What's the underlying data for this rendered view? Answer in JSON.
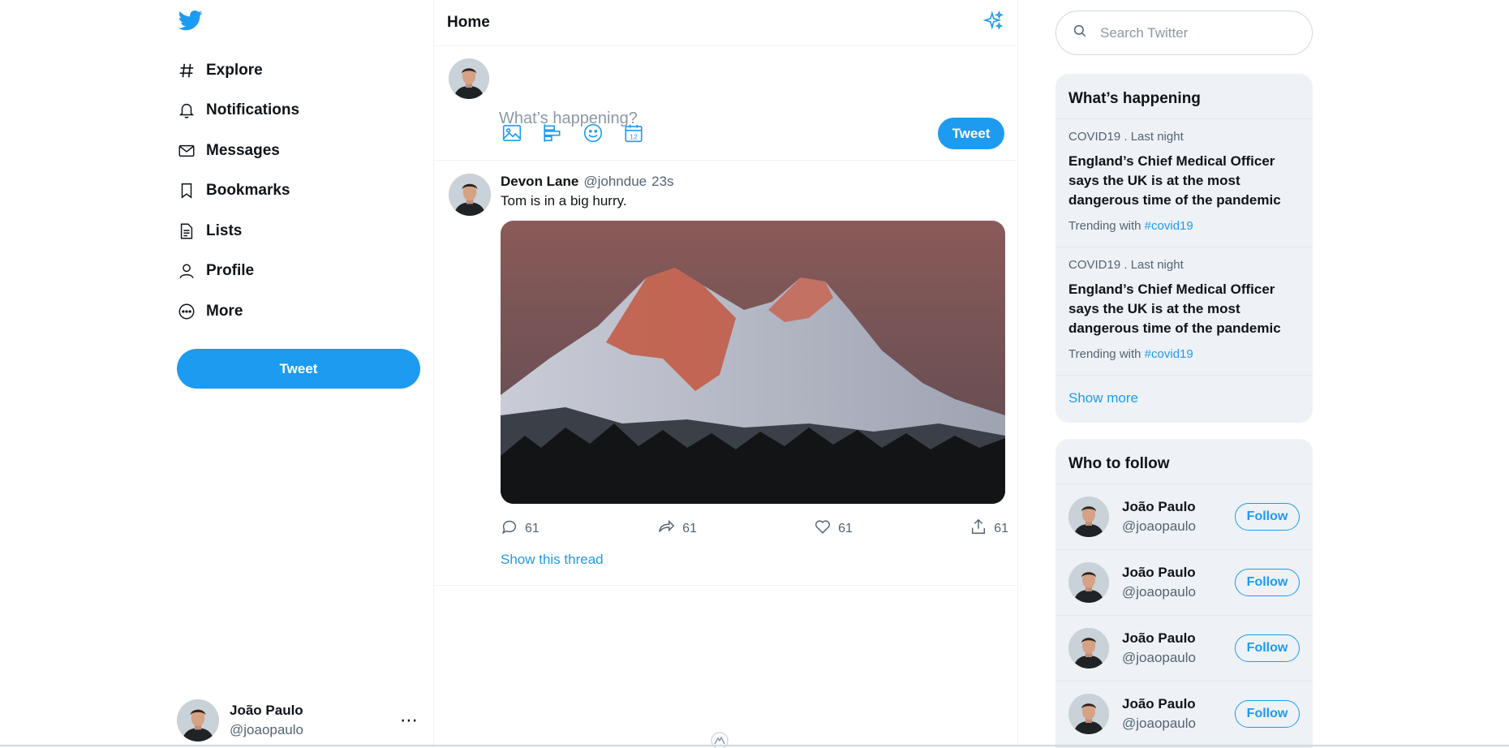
{
  "nav": {
    "items": [
      {
        "label": "Explore",
        "icon": "hashtag-icon"
      },
      {
        "label": "Notifications",
        "icon": "bell-icon"
      },
      {
        "label": "Messages",
        "icon": "envelope-icon"
      },
      {
        "label": "Bookmarks",
        "icon": "bookmark-icon"
      },
      {
        "label": "Lists",
        "icon": "document-icon"
      },
      {
        "label": "Profile",
        "icon": "person-icon"
      },
      {
        "label": "More",
        "icon": "more-circle-icon"
      }
    ],
    "tweet_label": "Tweet"
  },
  "account": {
    "name": "João Paulo",
    "handle": "@joaopaulo",
    "more": "⋯"
  },
  "home": {
    "title": "Home"
  },
  "compose": {
    "placeholder": "What’s happening?",
    "tweet_label": "Tweet"
  },
  "tweet": {
    "author": "Devon Lane",
    "handle": "@johndue",
    "time": "23s",
    "text": "Tom is in a big hurry.",
    "replies": "61",
    "retweets": "61",
    "likes": "61",
    "shares": "61",
    "thread_label": "Show this thread"
  },
  "search": {
    "placeholder": "Search Twitter"
  },
  "happening": {
    "title": "What’s happening",
    "trends": [
      {
        "category": "COVID19 . Last night",
        "headline": "England’s Chief Medical Officer says the UK is at the most dangerous time of the pandemic",
        "trending_prefix": "Trending with",
        "tag": "#covid19"
      },
      {
        "category": "COVID19 . Last night",
        "headline": "England’s Chief Medical Officer says the UK is at the most dangerous time of the pandemic",
        "trending_prefix": "Trending with",
        "tag": "#covid19"
      }
    ],
    "show_more": "Show more"
  },
  "follow": {
    "title": "Who to follow",
    "users": [
      {
        "name": "João Paulo",
        "handle": "@joaopaulo",
        "button": "Follow"
      },
      {
        "name": "João Paulo",
        "handle": "@joaopaulo",
        "button": "Follow"
      },
      {
        "name": "João Paulo",
        "handle": "@joaopaulo",
        "button": "Follow"
      },
      {
        "name": "João Paulo",
        "handle": "@joaopaulo",
        "button": "Follow"
      }
    ]
  },
  "colors": {
    "accent": "#1d9bf0",
    "panel": "#eef2f6",
    "muted": "#536471"
  }
}
